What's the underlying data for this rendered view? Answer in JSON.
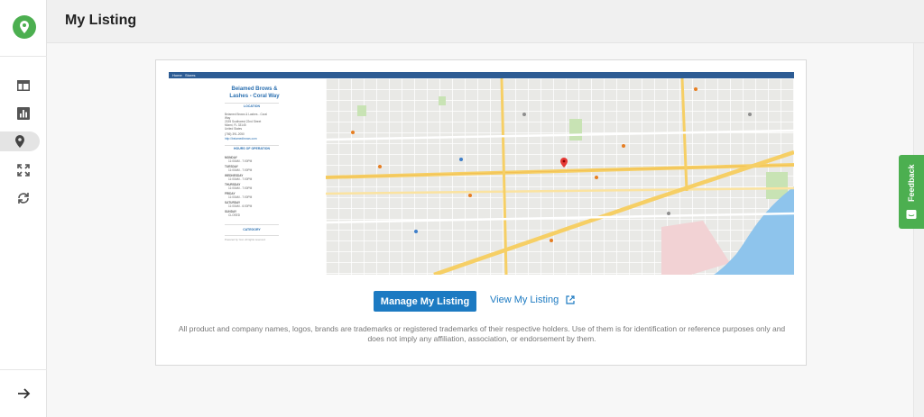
{
  "header": {
    "title": "My Listing"
  },
  "sidebar": {
    "items": [
      {
        "name": "dashboard",
        "icon": "dashboard-icon"
      },
      {
        "name": "reports",
        "icon": "bar-chart-icon"
      },
      {
        "name": "listing",
        "icon": "location-pin-icon",
        "active": true
      },
      {
        "name": "expand",
        "icon": "fullscreen-icon"
      },
      {
        "name": "sync",
        "icon": "sync-icon"
      }
    ],
    "expand_icon": "arrow-right-icon"
  },
  "preview": {
    "nav": [
      "Home",
      "Stores"
    ],
    "business_name": "Beiamed Brows & Lashes - Coral Way",
    "location_heading": "LOCATION",
    "address_lines": [
      "Beiamed Brows & Lashes - Coral",
      "Way",
      "2155 Southwest 22nd Street",
      "Miami, FL 33145",
      "United States",
      "(786) 391-2050",
      "http://beiamedbrows.com"
    ],
    "hours_heading": "HOURS OF OPERATION",
    "hours": [
      {
        "day": "MONDAY",
        "time": "11:00AM - 7:00PM"
      },
      {
        "day": "TUESDAY",
        "time": "11:00AM - 7:00PM"
      },
      {
        "day": "WEDNESDAY",
        "time": "11:00AM - 7:00PM"
      },
      {
        "day": "THURSDAY",
        "time": "11:00AM - 7:00PM"
      },
      {
        "day": "FRIDAY",
        "time": "11:00AM - 7:00PM"
      },
      {
        "day": "SATURDAY",
        "time": "11:00AM - 6:00PM"
      },
      {
        "day": "SUNDAY",
        "time": "CLOSED"
      }
    ],
    "category_heading": "CATEGORY",
    "footer": "Powered by Yext. All rights reserved."
  },
  "actions": {
    "manage_label": "Manage My Listing",
    "view_label": "View My Listing"
  },
  "disclaimer": "All product and company names, logos, brands are trademarks or registered trademarks of their respective holders. Use of them is for identification or reference purposes only and does not imply any affiliation, association, or endorsement by them.",
  "feedback": {
    "label": "Feedback"
  },
  "colors": {
    "brand_green": "#4caf50",
    "primary_blue": "#1c7ac2",
    "preview_nav": "#2d5c94",
    "map_road": "#f6cf65",
    "water": "#8ec4ec"
  }
}
